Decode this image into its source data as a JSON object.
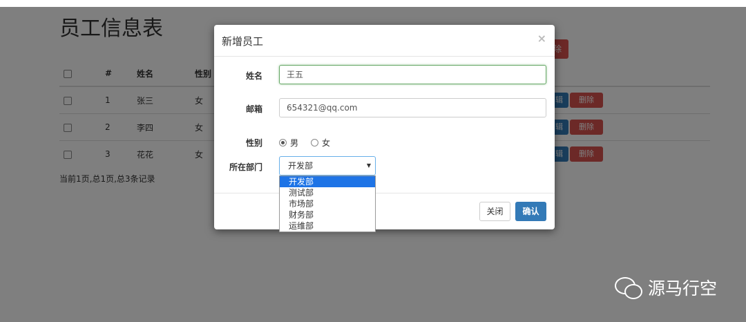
{
  "page": {
    "title": "员工信息表",
    "delete_top_label": "除",
    "footer_info": "当前1页,总1页,总3条记录",
    "watermark": "源马行空"
  },
  "table": {
    "headers": [
      "#",
      "姓名",
      "性别"
    ],
    "rows": [
      {
        "num": "1",
        "name": "张三",
        "gender": "女"
      },
      {
        "num": "2",
        "name": "李四",
        "gender": "女"
      },
      {
        "num": "3",
        "name": "花花",
        "gender": "女"
      }
    ],
    "edit_label": "辑",
    "delete_label": "删除"
  },
  "modal": {
    "title": "新增员工",
    "close_symbol": "×",
    "name_label": "姓名",
    "name_value": "王五",
    "email_label": "邮箱",
    "email_value": "654321@qq.com",
    "gender_label": "性别",
    "gender_male": "男",
    "gender_female": "女",
    "dept_label": "所在部门",
    "dept_selected": "开发部",
    "dept_options": [
      "开发部",
      "测试部",
      "市场部",
      "财务部",
      "运维部"
    ],
    "close_button": "关闭",
    "confirm_button": "确认"
  }
}
